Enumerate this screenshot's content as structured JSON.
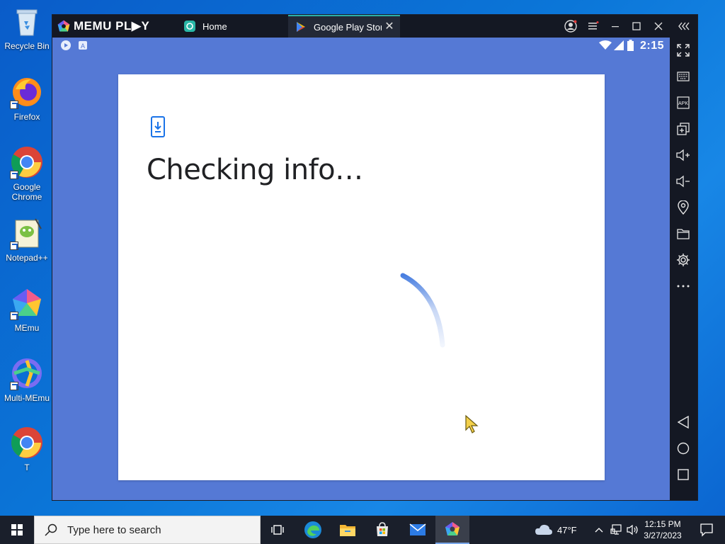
{
  "desktop": {
    "icons": [
      {
        "label": "Recycle Bin",
        "icon": "recycle-bin-icon"
      },
      {
        "label": "Firefox",
        "icon": "firefox-icon"
      },
      {
        "label": "Google Chrome",
        "icon": "chrome-icon"
      },
      {
        "label": "Notepad++",
        "icon": "notepadpp-icon"
      },
      {
        "label": "MEmu",
        "icon": "memu-icon"
      },
      {
        "label": "Multi-MEmu",
        "icon": "multi-memu-icon"
      },
      {
        "label": "T",
        "icon": "chrome-icon"
      }
    ]
  },
  "emulator": {
    "brand": "MEMU PL▶Y",
    "tabs": [
      {
        "label": "Home",
        "icon": "home-tab-icon"
      },
      {
        "label": "Google Play Store",
        "icon": "play-store-icon"
      }
    ],
    "status_time": "2:15",
    "sidebar_tools": [
      "fullscreen-icon",
      "keyboard-icon",
      "apk-icon",
      "multi-window-icon",
      "volume-up-icon",
      "volume-down-icon",
      "location-icon",
      "folder-icon",
      "settings-icon",
      "more-icon"
    ],
    "nav_buttons": [
      "back-icon",
      "home-icon",
      "recents-icon"
    ],
    "apk_text": "APK"
  },
  "dialog": {
    "title": "Checking info…",
    "icon": "phone-download-icon"
  },
  "taskbar": {
    "search_placeholder": "Type here to search",
    "apps": [
      "task-view-icon",
      "edge-icon",
      "file-explorer-icon",
      "store-icon",
      "mail-icon",
      "memu-icon"
    ],
    "weather": "47°F",
    "time": "12:15 PM",
    "date": "3/27/2023"
  },
  "colors": {
    "android_bg": "#5579d5",
    "accent_tab": "#2bb0a8",
    "taskbar": "#1a1f2b"
  }
}
